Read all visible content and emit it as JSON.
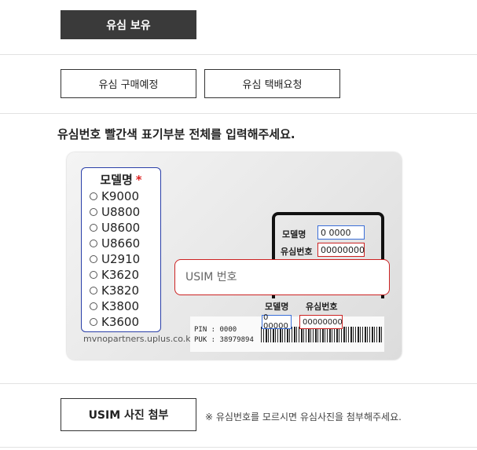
{
  "buttons": {
    "usim_owned": "유심 보유",
    "usim_purchase": "유심 구매예정",
    "usim_delivery": "유심 택배요청",
    "usim_photo": "USIM 사진 첨부"
  },
  "instruction": "유심번호 빨간색 표기부분 전체를 입력해주세요.",
  "model_panel": {
    "title": "모델명",
    "required_mark": "*",
    "options": [
      "K9000",
      "U8800",
      "U8600",
      "U8660",
      "U2910",
      "K3620",
      "K3820",
      "K3800",
      "K3600"
    ]
  },
  "card": {
    "domain": "mvnopartners.uplus.co.kr",
    "slot_model_label": "모델명",
    "slot_model_value": "0 0000",
    "slot_usim_label": "유심번호",
    "slot_usim_value": "00000000",
    "bottom_model_label": "모델명",
    "bottom_usim_label": "유심번호",
    "bottom_model_value": "0 00000",
    "bottom_usim_value": "00000000",
    "pin_text": "PIN : 0000",
    "puk_text": "PUK : 38979894"
  },
  "usim_input": {
    "placeholder": "USIM 번호"
  },
  "notice": "※ 유심번호를 모르시면 유심사진을 첨부해주세요.",
  "colors": {
    "dark_button": "#3a3a3a",
    "red_highlight": "#cc2222",
    "blue_highlight": "#3a6ed8",
    "panel_border": "#2a3fa8"
  }
}
